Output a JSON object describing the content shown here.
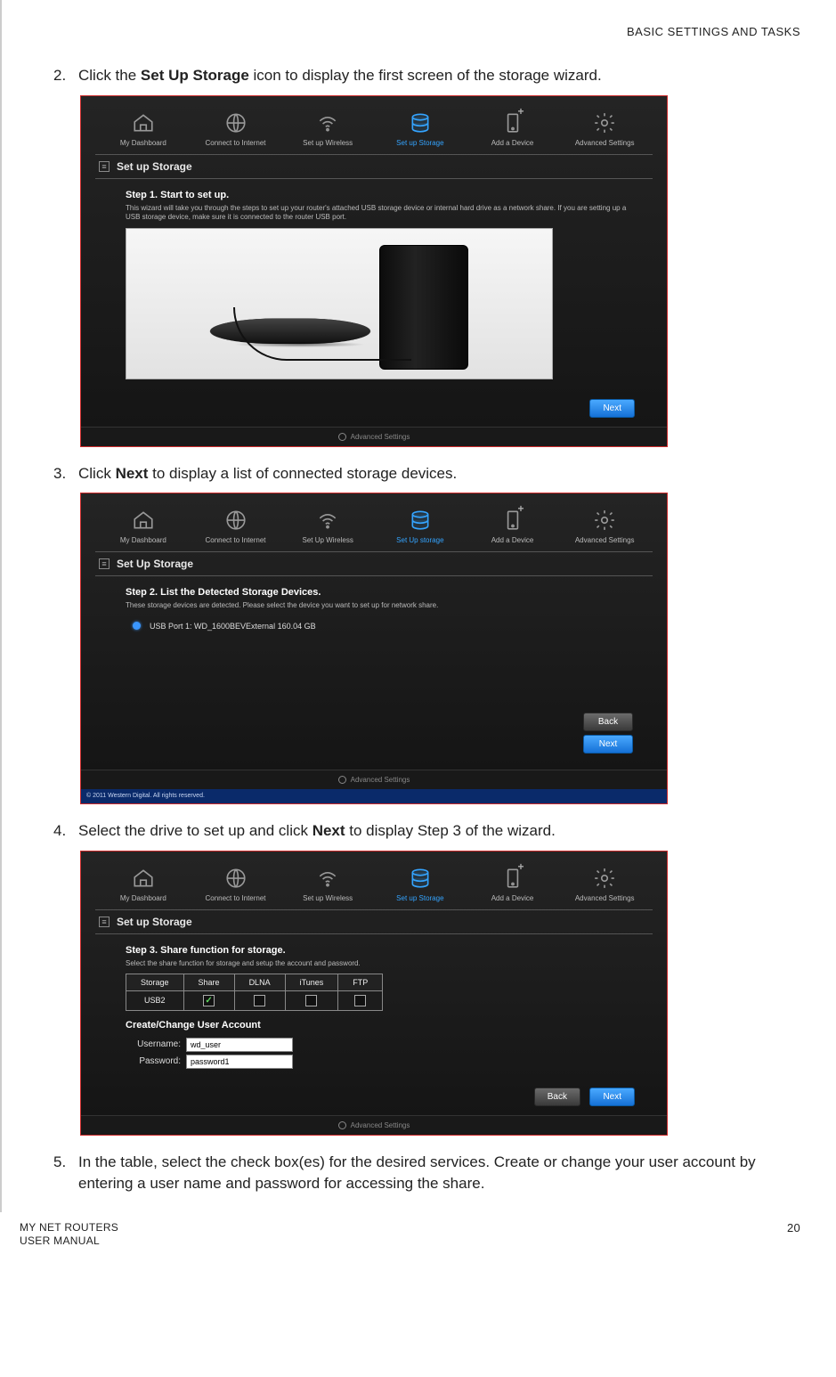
{
  "header": {
    "section": "BASIC SETTINGS AND TASKS"
  },
  "steps": {
    "s2": {
      "num": "2.",
      "pre": "Click the ",
      "bold": "Set Up Storage",
      "post": " icon to display the first screen of the storage wizard."
    },
    "s3": {
      "num": "3.",
      "pre": "Click ",
      "bold": "Next",
      "post": " to display a list of connected storage devices."
    },
    "s4": {
      "num": "4.",
      "pre": "Select the drive to set up and click ",
      "bold": "Next",
      "post": " to display Step 3 of the wizard."
    },
    "s5": {
      "num": "5.",
      "text": "In the table, select the check box(es) for the desired services. Create or change your user account by entering a user name and password for accessing the share."
    }
  },
  "nav": {
    "dashboard": "My Dashboard",
    "connect": "Connect to Internet",
    "wireless": "Set up Wireless",
    "storage": "Set up Storage",
    "storage_alt": "Set Up storage",
    "wireless_alt": "Set Up Wireless",
    "add": "Add a Device",
    "advanced": "Advanced Settings"
  },
  "panel1": {
    "title": "Set up Storage",
    "step_head": "Step 1. Start to set up.",
    "step_desc": "This wizard will take you through the steps to set up your router's attached USB storage device or internal hard drive as a network share. If you are setting up a USB storage device, make sure it is connected to the router USB port.",
    "next": "Next",
    "footer": "Advanced Settings"
  },
  "panel2": {
    "title": "Set Up Storage",
    "step_head": "Step 2. List the Detected Storage Devices.",
    "step_desc": "These storage devices are detected. Please select the device you want to set up for network share.",
    "device": "USB Port 1: WD_1600BEVExternal  160.04 GB",
    "back": "Back",
    "next": "Next",
    "footer": "Advanced Settings",
    "copyright": "© 2011 Western Digital. All rights reserved."
  },
  "panel3": {
    "title": "Set up Storage",
    "step_head": "Step 3. Share function for storage.",
    "step_desc": "Select the share function for storage and setup the account and password.",
    "cols": {
      "storage": "Storage",
      "share": "Share",
      "dlna": "DLNA",
      "itunes": "iTunes",
      "ftp": "FTP"
    },
    "row_storage": "USB2",
    "account_head": "Create/Change User Account",
    "username_label": "Username:",
    "username_value": "wd_user",
    "password_label": "Password:",
    "password_value": "password1",
    "back": "Back",
    "next": "Next",
    "footer": "Advanced Settings"
  },
  "footer": {
    "line1": "MY NET ROUTERS",
    "line2": "USER MANUAL",
    "page": "20"
  }
}
